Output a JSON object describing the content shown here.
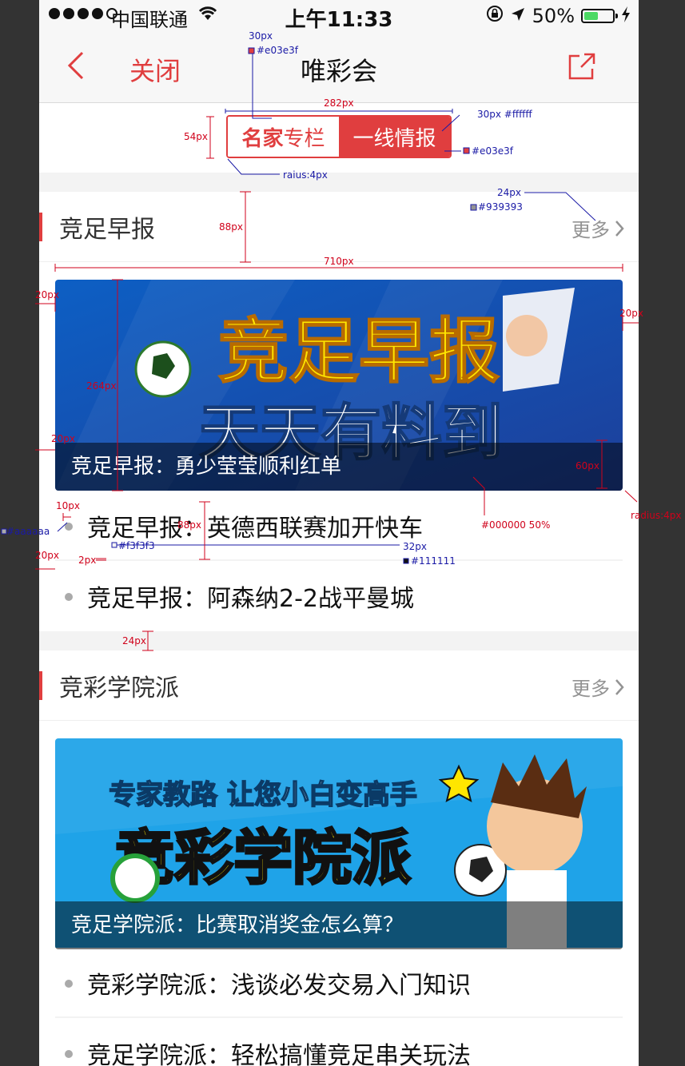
{
  "status_bar": {
    "carrier": "中国联通",
    "time": "上午11:33",
    "battery": "50%",
    "battery_level": 0.5
  },
  "nav": {
    "close_label": "关闭",
    "title": "唯彩会"
  },
  "segment": {
    "active_strong": "名家",
    "active_rest": "专栏",
    "inactive": "一线情报"
  },
  "colors": {
    "accent": "#e03e3f",
    "text": "#111111",
    "more": "#939393",
    "dot": "#aaaaaa",
    "divider": "#f3f3f3"
  },
  "sections": [
    {
      "title": "竞足早报",
      "more": "更多",
      "banner": {
        "line1": "竞足早报",
        "line2": "天天有料到",
        "caption": "竞足早报：勇少莹莹顺利红单"
      },
      "items": [
        "竞足早报：英德西联赛加开快车",
        "竞足早报：阿森纳2-2战平曼城"
      ]
    },
    {
      "title": "竞彩学院派",
      "more": "更多",
      "banner": {
        "line1": "专家教路 让您小白变高手",
        "line2": "竞彩学院派",
        "caption": "竞足学院派：比赛取消奖金怎么算？"
      },
      "items": [
        "竞彩学院派：浅谈必发交易入门知识",
        "竞足学院派：轻松搞懂竞足串关玩法"
      ]
    }
  ],
  "annotations": {
    "a30px": "30px",
    "a_e03e3f_1": "#e03e3f",
    "a282px": "282px",
    "a30px_fff": "30px #ffffff",
    "a54px": "54px",
    "a_e03e3f_2": "#e03e3f",
    "a_raius": "raius:4px",
    "a24px": "24px",
    "a_939393": "#939393",
    "a88px_1": "88px",
    "a710px": "710px",
    "a20px_1": "20px",
    "a20px_2": "20px",
    "a264px": "264px",
    "a20px_3": "20px",
    "a60px": "60px",
    "a_radius": "radius:4px",
    "a000000": "#000000 50%",
    "a10px": "10px",
    "a_aaaaaa": "#aaaaaa",
    "a88px_2": "88px",
    "a_f3f3f3": "#f3f3f3",
    "a32px": "32px",
    "a_111111": "#111111",
    "a20px_4": "20px",
    "a2px": "2px",
    "a24px_2": "24px"
  }
}
